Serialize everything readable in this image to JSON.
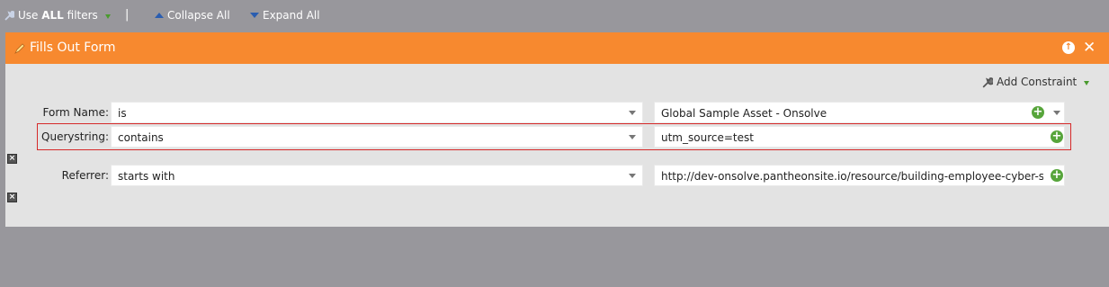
{
  "toolbar": {
    "use_prefix": "Use ",
    "use_bold": "ALL",
    "use_suffix": " filters",
    "separator": "|",
    "collapse_all": "Collapse All",
    "expand_all": "Expand All"
  },
  "panel": {
    "title": "Fills Out Form",
    "add_constraint": "Add Constraint",
    "rows": [
      {
        "label": "Form Name:",
        "operator": "is",
        "value": "Global Sample Asset - Onsolve"
      },
      {
        "label": "Querystring:",
        "operator": "contains",
        "value": "utm_source=test"
      },
      {
        "label": "Referrer:",
        "operator": "starts with",
        "value": "http://dev-onsolve.pantheonsite.io/resource/building-employee-cyber-security-awareness"
      }
    ]
  },
  "colors": {
    "header": "#f7892f",
    "background": "#98979c",
    "panel": "#e3e3e3",
    "highlight": "#d62a2a",
    "add": "#57a53b"
  },
  "icons": [
    "wrench-icon",
    "chevron-up-icon",
    "chevron-down-icon",
    "pencil-icon",
    "move-up-icon",
    "close-icon",
    "plus-icon",
    "remove-icon"
  ]
}
